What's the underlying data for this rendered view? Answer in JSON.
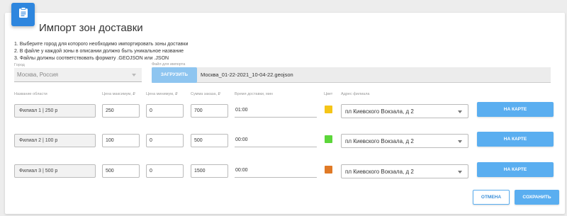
{
  "header": {
    "icon": "clipboard-icon",
    "title": "Импорт зон доставки",
    "accent_color": "#2e86de"
  },
  "instructions": [
    "1. Выберите город для которого необходимо импортировать зоны доставки",
    "2. В файле у каждой зоны в описании должно быть уникальное название",
    "3. Файлы должны соответствовать формату .GEOJSON или .JSON"
  ],
  "city": {
    "label": "Город",
    "value": "Москва, Россия"
  },
  "file": {
    "label": "Файл для импорта",
    "upload_label": "ЗАГРУЗИТЬ",
    "file_name": "Москва_01-22-2021_10-04-22.geojson"
  },
  "columns": {
    "name": "Название области",
    "price_max": "Цена максимум, ₽",
    "price_min": "Цена минимум, ₽",
    "order_sum": "Сумма заказа, ₽",
    "delivery_time": "Время доставки, мин",
    "color": "Цвет",
    "branch_address": "Адрес филиала"
  },
  "zones": [
    {
      "name": "Филиал 1 | 250 р",
      "price_max": "250",
      "price_min": "0",
      "order_sum": "700",
      "delivery_time": "01:00",
      "color": "#f5c518",
      "address": "пл Киевского Вокзала, д 2",
      "map_label": "НА КАРТЕ"
    },
    {
      "name": "Филиал 2 | 100 р",
      "price_max": "100",
      "price_min": "0",
      "order_sum": "500",
      "delivery_time": "00:00",
      "color": "#5cd63a",
      "address": "пл Киевского Вокзала, д 2",
      "map_label": "НА КАРТЕ"
    },
    {
      "name": "Филиал 3 | 500 р",
      "price_max": "500",
      "price_min": "0",
      "order_sum": "1500",
      "delivery_time": "00:00",
      "color": "#e07a26",
      "address": "пл Киевского Вокзала, д 2",
      "map_label": "НА КАРТЕ"
    }
  ],
  "footer": {
    "cancel_label": "ОТМЕНА",
    "save_label": "СОХРАНИТЬ"
  }
}
